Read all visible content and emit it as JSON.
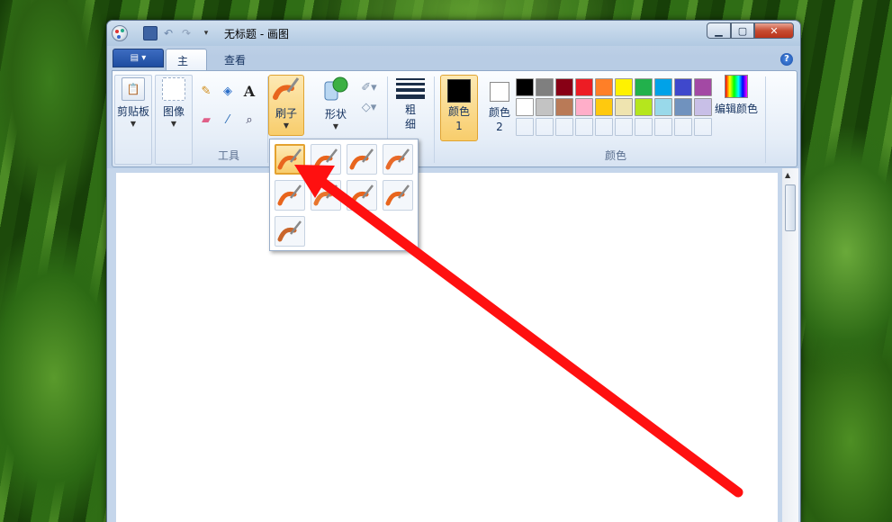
{
  "window": {
    "title": "无标题 - 画图"
  },
  "tabs": {
    "home": "主页",
    "view": "查看"
  },
  "groups": {
    "clipboard": "剪贴板",
    "image": "图像",
    "tools": "工具",
    "brushes": "刷子",
    "shapes": "形状",
    "size": "粗细",
    "color1": "颜色 1",
    "color2": "颜色 2",
    "colors": "颜色",
    "edit_colors": "编辑颜色"
  },
  "palette": [
    "#000000",
    "#7f7f7f",
    "#880015",
    "#ed1c24",
    "#ff7f27",
    "#fff200",
    "#22b14c",
    "#00a2e8",
    "#3f48cc",
    "#a349a4",
    "#ffffff",
    "#c3c3c3",
    "#b97a57",
    "#ffaec9",
    "#ffc90e",
    "#efe4b0",
    "#b5e61d",
    "#99d9ea",
    "#7092be",
    "#c8bfe7"
  ],
  "color1": "#000000",
  "color2": "#ffffff",
  "brush_menu": {
    "items": [
      "brush",
      "calligraphy-brush-1",
      "calligraphy-brush-2",
      "airbrush",
      "oil-brush",
      "crayon",
      "marker",
      "natural-pencil",
      "watercolor-brush"
    ],
    "selected": "brush"
  },
  "accent": "#ff0000"
}
